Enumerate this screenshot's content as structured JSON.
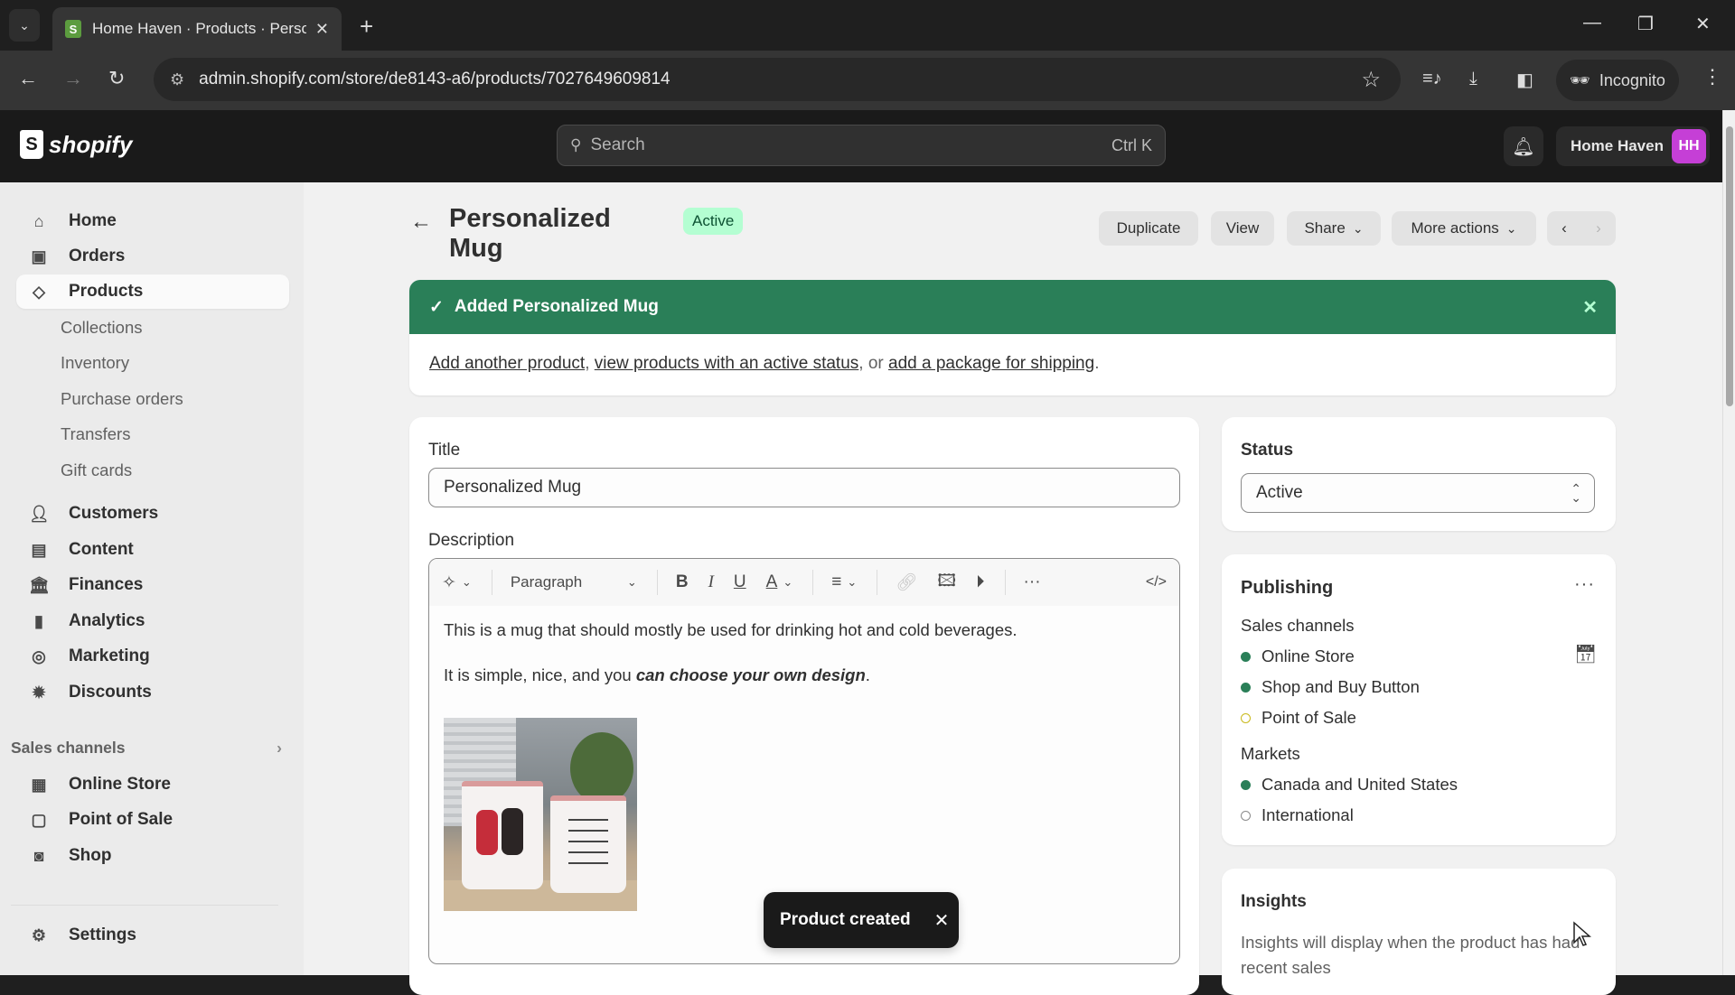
{
  "browser": {
    "tab_title": "Home Haven · Products · Personalized Mug",
    "tab_favicon": "S",
    "new_tab_label": "+",
    "url": "admin.shopify.com/store/de8143-a6/products/7027649609814",
    "incognito_label": "Incognito",
    "icons": {
      "tab_list": "chevron-down-icon",
      "back": "arrow-left-icon",
      "forward": "arrow-right-icon",
      "reload": "reload-icon",
      "site_info": "site-settings-icon",
      "bookmark": "star-icon",
      "media": "media-controls-icon",
      "downloads": "download-icon",
      "side_panel": "side-panel-icon",
      "menu": "kebab-menu-icon"
    }
  },
  "topbar": {
    "logo_text": "shopify",
    "search_placeholder": "Search",
    "search_shortcut": "Ctrl K",
    "store_name": "Home Haven",
    "store_initials": "HH",
    "avatar_color": "#c53fd6"
  },
  "sidebar": {
    "main_items": [
      {
        "label": "Home",
        "icon": "home-icon"
      },
      {
        "label": "Orders",
        "icon": "inbox-icon"
      },
      {
        "label": "Products",
        "icon": "tag-icon",
        "active": true
      }
    ],
    "product_subitems": [
      "Collections",
      "Inventory",
      "Purchase orders",
      "Transfers",
      "Gift cards"
    ],
    "more_items": [
      {
        "label": "Customers",
        "icon": "person-icon"
      },
      {
        "label": "Content",
        "icon": "content-icon"
      },
      {
        "label": "Finances",
        "icon": "bank-icon"
      },
      {
        "label": "Analytics",
        "icon": "bar-chart-icon"
      },
      {
        "label": "Marketing",
        "icon": "target-icon"
      },
      {
        "label": "Discounts",
        "icon": "discount-icon"
      }
    ],
    "sales_channels_label": "Sales channels",
    "sales_channels": [
      {
        "label": "Online Store",
        "icon": "store-icon"
      },
      {
        "label": "Point of Sale",
        "icon": "pos-icon"
      },
      {
        "label": "Shop",
        "icon": "shop-icon"
      }
    ],
    "settings_label": "Settings"
  },
  "page": {
    "title": "Personalized Mug",
    "status_badge": "Active",
    "actions": {
      "duplicate": "Duplicate",
      "view": "View",
      "share": "Share",
      "more_actions": "More actions"
    }
  },
  "banner": {
    "title": "Added Personalized Mug",
    "link_add_another": "Add another product",
    "link_view_active": "view products with an active status",
    "separator_or": ", or ",
    "comma": ", ",
    "link_add_package": "add a package for shipping",
    "period": ".",
    "color": "#2a7f58"
  },
  "product_form": {
    "title_label": "Title",
    "title_value": "Personalized Mug",
    "description_label": "Description",
    "toolbar": {
      "format_select": "Paragraph",
      "bold": "B",
      "italic": "I",
      "underline": "U",
      "text_color": "A",
      "more": "···",
      "code": "</>"
    },
    "description_line1": "This is a mug that should mostly be used for drinking hot and cold beverages.",
    "description_line2_plain": "It is simple, nice, and you ",
    "description_line2_emph": "can choose your own design",
    "description_line2_end": ".",
    "image_alt": "Two white personalized mugs with pink rims"
  },
  "status_card": {
    "label": "Status",
    "value": "Active"
  },
  "publishing_card": {
    "title": "Publishing",
    "sales_channels_label": "Sales channels",
    "channels": [
      {
        "label": "Online Store",
        "state": "on"
      },
      {
        "label": "Shop and Buy Button",
        "state": "on"
      },
      {
        "label": "Point of Sale",
        "state": "warn"
      }
    ],
    "markets_label": "Markets",
    "markets": [
      {
        "label": "Canada and United States",
        "state": "on"
      },
      {
        "label": "International",
        "state": "off"
      }
    ]
  },
  "insights_card": {
    "title": "Insights",
    "body": "Insights will display when the product has had recent sales"
  },
  "toast": {
    "message": "Product created"
  }
}
